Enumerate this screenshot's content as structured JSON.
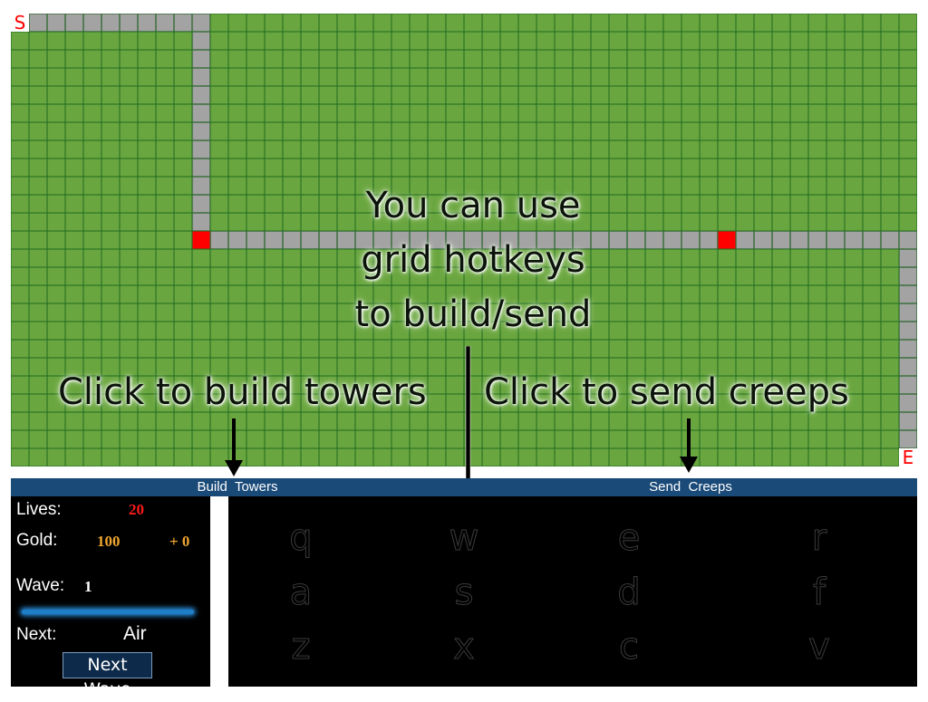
{
  "board": {
    "start_label": "S",
    "end_label": "E",
    "colors": {
      "grass": "#6aa63f",
      "grid_line": "#1f6b22",
      "path": "#a3a3a3",
      "marker": "#ff0000"
    }
  },
  "hints": {
    "center_line1": "You can use",
    "center_line2": "grid hotkeys",
    "center_line3": "to build/send",
    "build": "Click to build towers",
    "send": "Click to send creeps"
  },
  "panel": {
    "build_header_a": "Build",
    "build_header_b": "Towers",
    "send_header_a": "Send",
    "send_header_b": "Creeps"
  },
  "stats": {
    "lives_label": "Lives:",
    "lives": "20",
    "gold_label": "Gold:",
    "gold": "100",
    "income": "+ 0",
    "wave_label": "Wave:",
    "wave": "1",
    "next_label": "Next:",
    "next_type": "Air",
    "next_wave_button": "Next Wave",
    "colors": {
      "lives": "#ff1a1a",
      "gold": "#f0a630"
    }
  },
  "hotkeys": {
    "row1": [
      "q",
      "w",
      "e",
      "r"
    ],
    "row2": [
      "a",
      "s",
      "d",
      "f"
    ],
    "row3": [
      "z",
      "x",
      "c",
      "v"
    ]
  }
}
